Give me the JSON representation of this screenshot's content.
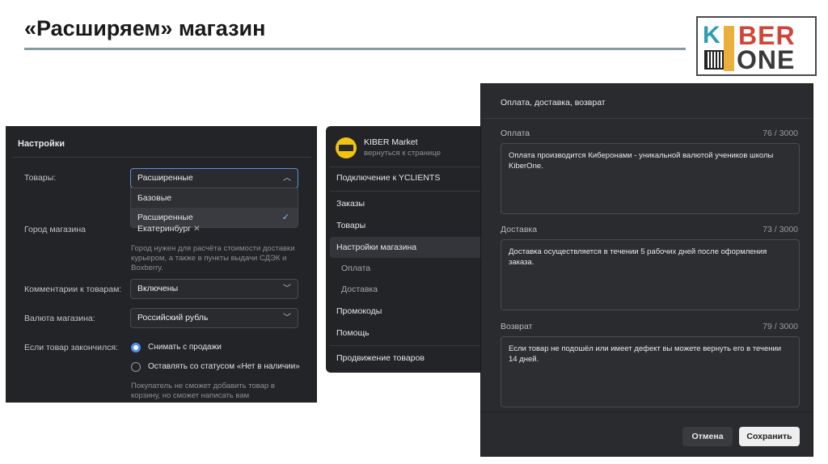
{
  "slide": {
    "title": "«Расширяем» магазин",
    "logo": {
      "k": "K",
      "ber": "BER",
      "one": "ONE"
    }
  },
  "settings": {
    "header": "Настройки",
    "goods_label": "Товары:",
    "goods_value": "Расширенные",
    "goods_options": [
      "Базовые",
      "Расширенные"
    ],
    "city_label": "Город магазина",
    "city_chip": "Екатеринбург",
    "city_hint": [
      "Город нужен для расчёта стоимости доставки",
      "курьером, а также в пункты выдачи СДЭК и",
      "Boxberry."
    ],
    "comments_label": "Комментарии к товарам:",
    "comments_value": "Включены",
    "currency_label": "Валюта магазина:",
    "currency_value": "Российский рубль",
    "oos_label": "Если товар закончился:",
    "oos_options": [
      "Снимать с продажи",
      "Оставлять со статусом «Нет в наличии»"
    ],
    "oos_hint": [
      "Покупатель не сможет добавить товар в",
      "корзину, но сможет написать вам"
    ]
  },
  "nav": {
    "brand_name": "KIBER Market",
    "brand_back": "вернуться к странице",
    "connect": "Подключение к YCLIENTS",
    "items": [
      "Заказы",
      "Товары",
      "Настройки магазина"
    ],
    "subitems": [
      "Оплата",
      "Доставка"
    ],
    "items2": [
      "Промокоды",
      "Помощь"
    ],
    "promo": "Продвижение товаров"
  },
  "dialog": {
    "title": "Оплата, доставка, возврат",
    "fields": [
      {
        "label": "Оплата",
        "count": "76 / 3000",
        "text": "Оплата производится Киберонами - уникальной валютой учеников школы KiberOne."
      },
      {
        "label": "Доставка",
        "count": "73 / 3000",
        "text": "Доставка осуществляется в течении 5 рабочих дней после оформления заказа."
      },
      {
        "label": "Возврат",
        "count": "79 / 3000",
        "text": "Если товар не подошёл или имеет дефект вы можете вернуть его в течении 14 дней."
      }
    ],
    "cancel": "Отмена",
    "save": "Сохранить"
  },
  "colors": {
    "panel": "#232427",
    "accent": "#4d8ef0",
    "rule": "#8a9aa1"
  }
}
